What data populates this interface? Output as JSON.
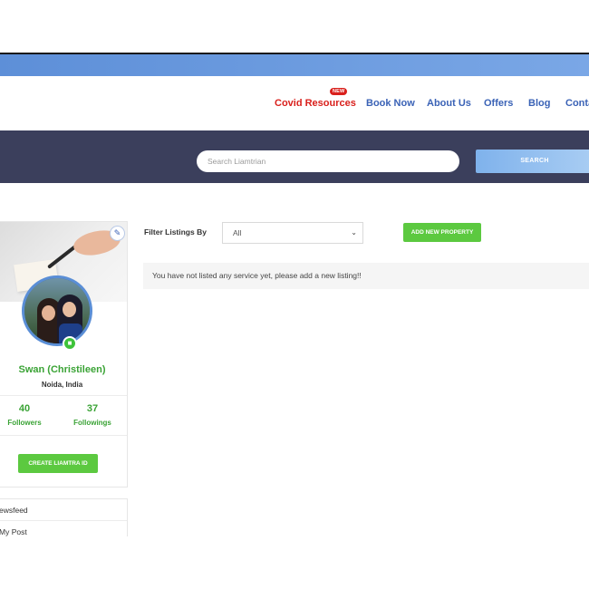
{
  "nav": {
    "items": [
      {
        "label": "Covid Resources"
      },
      {
        "label": "Book Now"
      },
      {
        "label": "About Us"
      },
      {
        "label": "Offers"
      },
      {
        "label": "Blog"
      },
      {
        "label": "Conta"
      }
    ],
    "new_badge": "NEW"
  },
  "search": {
    "placeholder": "Search Liamtrian",
    "button_label": "SEARCH"
  },
  "profile": {
    "name": "Swan (Christileen)",
    "location": "Noida, India",
    "followers_count": "40",
    "followers_label": "Followers",
    "followings_count": "37",
    "followings_label": "Followings",
    "create_id_label": "CREATE LIAMTRA ID"
  },
  "menu": {
    "items": [
      {
        "label": "ewsfeed"
      },
      {
        "label": "My Post"
      }
    ]
  },
  "listings": {
    "filter_label": "Filter Listings By",
    "filter_value": "All",
    "add_button_label": "ADD NEW PROPERTY",
    "empty_message": "You have not listed any service yet, please add a new listing!!"
  },
  "colors": {
    "accent_green": "#3aa335",
    "button_green": "#5cc940",
    "nav_blue": "#3a62b6",
    "covid_red": "#d9201c",
    "search_band": "#3b3f5c"
  }
}
